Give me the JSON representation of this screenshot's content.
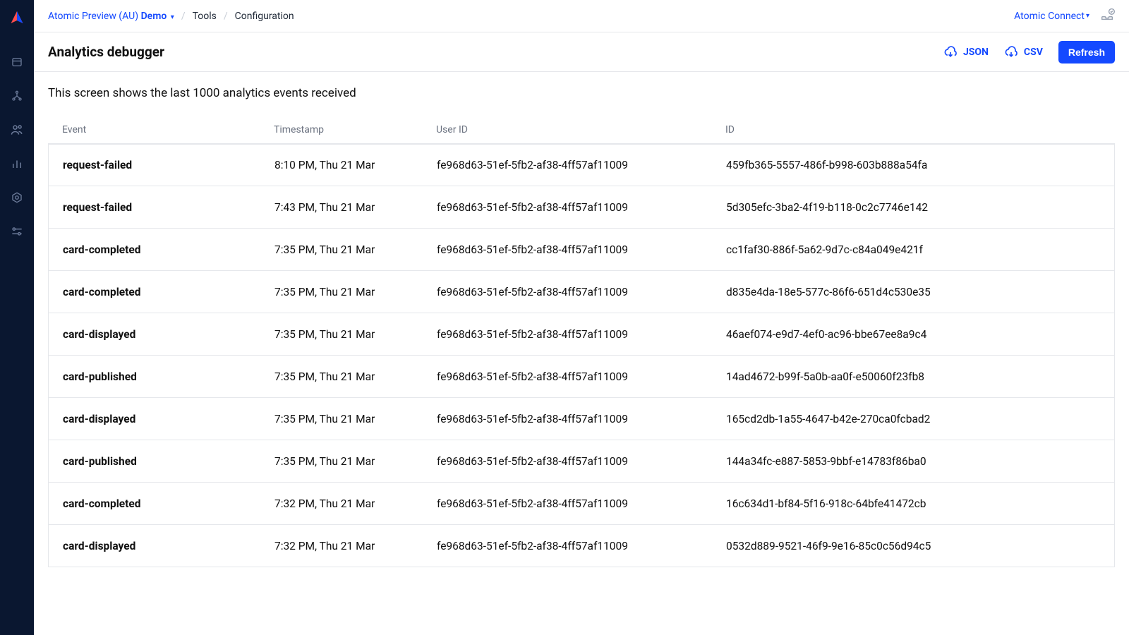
{
  "breadcrumbs": {
    "org_label": "Atomic Preview (AU)",
    "env_label": "Demo",
    "section": "Tools",
    "page": "Configuration"
  },
  "topbar": {
    "connect_label": "Atomic Connect"
  },
  "header": {
    "title": "Analytics debugger",
    "json_label": "JSON",
    "csv_label": "CSV",
    "refresh_label": "Refresh"
  },
  "description": "This screen shows the last 1000 analytics events received",
  "table": {
    "columns": {
      "event": "Event",
      "timestamp": "Timestamp",
      "user_id": "User ID",
      "id": "ID"
    },
    "rows": [
      {
        "event": "request-failed",
        "timestamp": "8:10 PM, Thu 21 Mar",
        "user_id": "fe968d63-51ef-5fb2-af38-4ff57af11009",
        "id": "459fb365-5557-486f-b998-603b888a54fa"
      },
      {
        "event": "request-failed",
        "timestamp": "7:43 PM, Thu 21 Mar",
        "user_id": "fe968d63-51ef-5fb2-af38-4ff57af11009",
        "id": "5d305efc-3ba2-4f19-b118-0c2c7746e142"
      },
      {
        "event": "card-completed",
        "timestamp": "7:35 PM, Thu 21 Mar",
        "user_id": "fe968d63-51ef-5fb2-af38-4ff57af11009",
        "id": "cc1faf30-886f-5a62-9d7c-c84a049e421f"
      },
      {
        "event": "card-completed",
        "timestamp": "7:35 PM, Thu 21 Mar",
        "user_id": "fe968d63-51ef-5fb2-af38-4ff57af11009",
        "id": "d835e4da-18e5-577c-86f6-651d4c530e35"
      },
      {
        "event": "card-displayed",
        "timestamp": "7:35 PM, Thu 21 Mar",
        "user_id": "fe968d63-51ef-5fb2-af38-4ff57af11009",
        "id": "46aef074-e9d7-4ef0-ac96-bbe67ee8a9c4"
      },
      {
        "event": "card-published",
        "timestamp": "7:35 PM, Thu 21 Mar",
        "user_id": "fe968d63-51ef-5fb2-af38-4ff57af11009",
        "id": "14ad4672-b99f-5a0b-aa0f-e50060f23fb8"
      },
      {
        "event": "card-displayed",
        "timestamp": "7:35 PM, Thu 21 Mar",
        "user_id": "fe968d63-51ef-5fb2-af38-4ff57af11009",
        "id": "165cd2db-1a55-4647-b42e-270ca0fcbad2"
      },
      {
        "event": "card-published",
        "timestamp": "7:35 PM, Thu 21 Mar",
        "user_id": "fe968d63-51ef-5fb2-af38-4ff57af11009",
        "id": "144a34fc-e887-5853-9bbf-e14783f86ba0"
      },
      {
        "event": "card-completed",
        "timestamp": "7:32 PM, Thu 21 Mar",
        "user_id": "fe968d63-51ef-5fb2-af38-4ff57af11009",
        "id": "16c634d1-bf84-5f16-918c-64bfe41472cb"
      },
      {
        "event": "card-displayed",
        "timestamp": "7:32 PM, Thu 21 Mar",
        "user_id": "fe968d63-51ef-5fb2-af38-4ff57af11009",
        "id": "0532d889-9521-46f9-9e16-85c0c56d94c5"
      }
    ]
  }
}
